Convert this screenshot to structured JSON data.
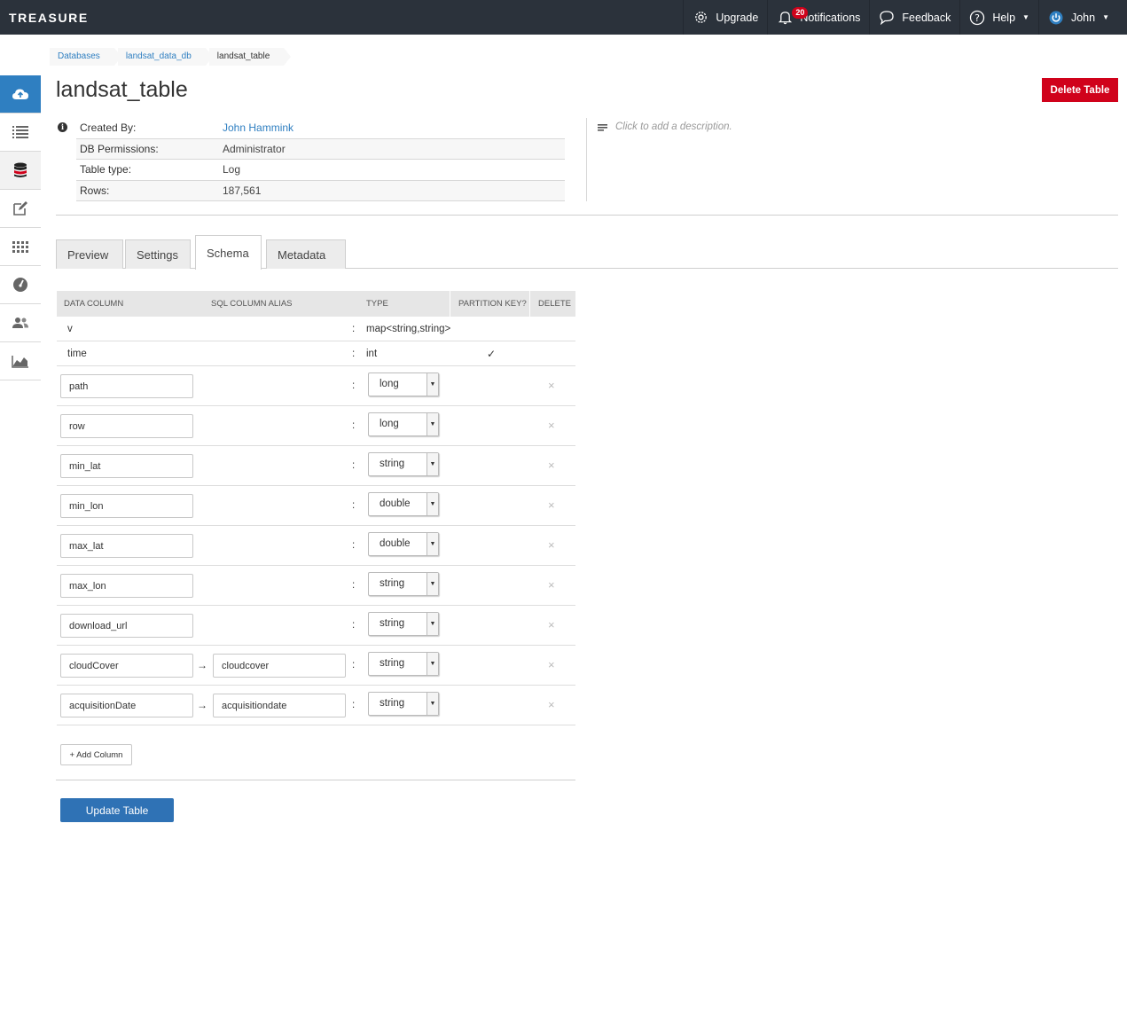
{
  "app": {
    "logo": "TREASURE"
  },
  "topnav": {
    "upgrade": "Upgrade",
    "notifications": "Notifications",
    "notifications_count": "20",
    "feedback": "Feedback",
    "help": "Help",
    "user": "John"
  },
  "sidebar": {
    "items": [
      "cloud-upload-icon",
      "list-icon",
      "database-icon",
      "edit-icon",
      "grid-icon",
      "gauge-icon",
      "users-icon",
      "chart-icon"
    ]
  },
  "breadcrumb": [
    "Databases",
    "landsat_data_db",
    "landsat_table"
  ],
  "page": {
    "title": "landsat_table",
    "delete_label": "Delete Table"
  },
  "info": {
    "rows": [
      {
        "key": "Created By:",
        "value": "John Hammink"
      },
      {
        "key": "DB Permissions:",
        "value": "Administrator"
      },
      {
        "key": "Table type:",
        "value": "Log"
      },
      {
        "key": "Rows:",
        "value": "187,561"
      }
    ],
    "description_placeholder": "Click to add a description."
  },
  "tabs": [
    "Preview",
    "Settings",
    "Schema",
    "Metadata"
  ],
  "active_tab": "Schema",
  "schema": {
    "headers": [
      "DATA COLUMN",
      "SQL COLUMN ALIAS",
      "TYPE",
      "PARTITION KEY?",
      "DELETE"
    ],
    "static_rows": [
      {
        "name": "v",
        "type": "map<string,string>",
        "partition_key": ""
      },
      {
        "name": "time",
        "type": "int",
        "partition_key": "✓"
      }
    ],
    "edit_rows": [
      {
        "name": "path",
        "alias": "",
        "type": "long"
      },
      {
        "name": "row",
        "alias": "",
        "type": "long"
      },
      {
        "name": "min_lat",
        "alias": "",
        "type": "string"
      },
      {
        "name": "min_lon",
        "alias": "",
        "type": "double"
      },
      {
        "name": "max_lat",
        "alias": "",
        "type": "double"
      },
      {
        "name": "max_lon",
        "alias": "",
        "type": "string"
      },
      {
        "name": "download_url",
        "alias": "",
        "type": "string"
      },
      {
        "name": "cloudCover",
        "alias": "cloudcover",
        "type": "string"
      },
      {
        "name": "acquisitionDate",
        "alias": "acquisitiondate",
        "type": "string"
      }
    ],
    "colon": ":",
    "arrow": "→",
    "delete_glyph": "×",
    "add_column_label": "+ Add Column",
    "update_label": "Update Table"
  },
  "colors": {
    "topbar": "#2b323b",
    "accent": "#2f7fc1",
    "danger": "#d0021b",
    "primary_button": "#2f72b5"
  }
}
